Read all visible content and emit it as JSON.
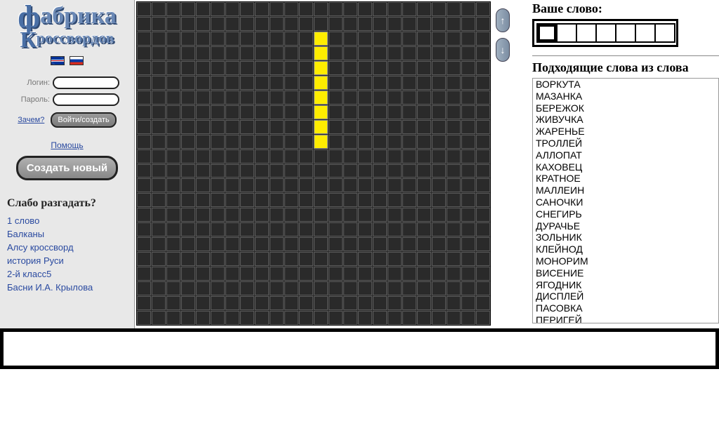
{
  "logo": {
    "line1": "фабрика",
    "line2": "Кроссвордов"
  },
  "login": {
    "login_label": "Логин:",
    "password_label": "Пароль:",
    "why_link": "Зачем?",
    "submit": "Войти/создать"
  },
  "help_link": "Помощь",
  "create_button": "Создать новый",
  "challenge": {
    "heading": "Слабо разгадать?",
    "items": [
      "1 слово",
      "Балканы",
      "Алсу кроссворд",
      "история Руси",
      "2-й класс5",
      "Басни И.А. Крылова"
    ]
  },
  "grid": {
    "cols": 24,
    "rows": 22,
    "yellow_col": 12,
    "yellow_row_start": 2,
    "yellow_row_end": 9
  },
  "arrows": {
    "up": "↑",
    "down": "↓"
  },
  "right": {
    "your_word": "Ваше слово:",
    "word_length": 7,
    "suggestions_heading": "Подходящие слова из слова",
    "words": [
      "ВОРКУТА",
      "МАЗАНКА",
      "БЕРЕЖОК",
      "ЖИВУЧКА",
      "ЖАРЕНЬЕ",
      "ТРОЛЛЕЙ",
      "АЛЛОПАТ",
      "КАХОВЕЦ",
      "КРАТНОЕ",
      "МАЛЛЕИН",
      "САНОЧКИ",
      "СНЕГИРЬ",
      "ДУРАЧЬЕ",
      "ЗОЛЬНИК",
      "КЛЕЙНОД",
      "МОНОРИМ",
      "ВИСЕНИЕ",
      "ЯГОДНИК",
      "ДИСПЛЕЙ",
      "ПАСОВКА",
      "ПЕРИГЕЙ"
    ]
  }
}
